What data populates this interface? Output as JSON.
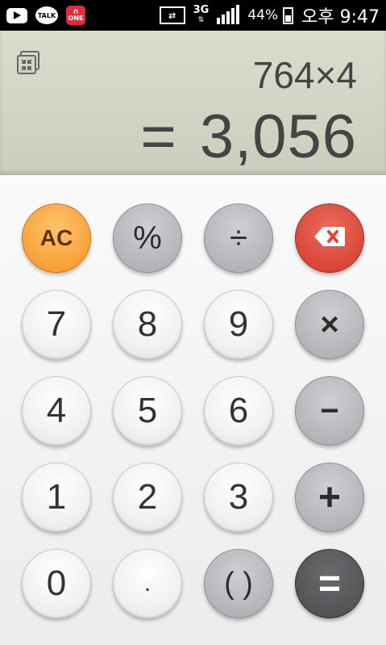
{
  "status_bar": {
    "left_icons": [
      "youtube-icon",
      "kakaotalk-icon",
      "one-store-icon"
    ],
    "talk_label": "TALK",
    "one_label": "ONE",
    "network_type": "3G",
    "battery_percent": "44%",
    "battery_level": 0.44,
    "time": "오후 9:47"
  },
  "display": {
    "expression": "764×4",
    "equals_sign": "=",
    "result": "3,056"
  },
  "keys": {
    "ac": "AC",
    "percent": "%",
    "divide": "÷",
    "backspace": "backspace-icon",
    "seven": "7",
    "eight": "8",
    "nine": "9",
    "multiply": "×",
    "four": "4",
    "five": "5",
    "six": "6",
    "minus": "−",
    "one": "1",
    "two": "2",
    "three": "3",
    "plus": "+",
    "zero": "0",
    "decimal": ".",
    "parentheses": "( )",
    "equals": "="
  },
  "colors": {
    "ac_key": "#f9a23a",
    "delete_key": "#d9483a",
    "equals_key": "#555558",
    "display_bg": "#d6d6c7"
  }
}
